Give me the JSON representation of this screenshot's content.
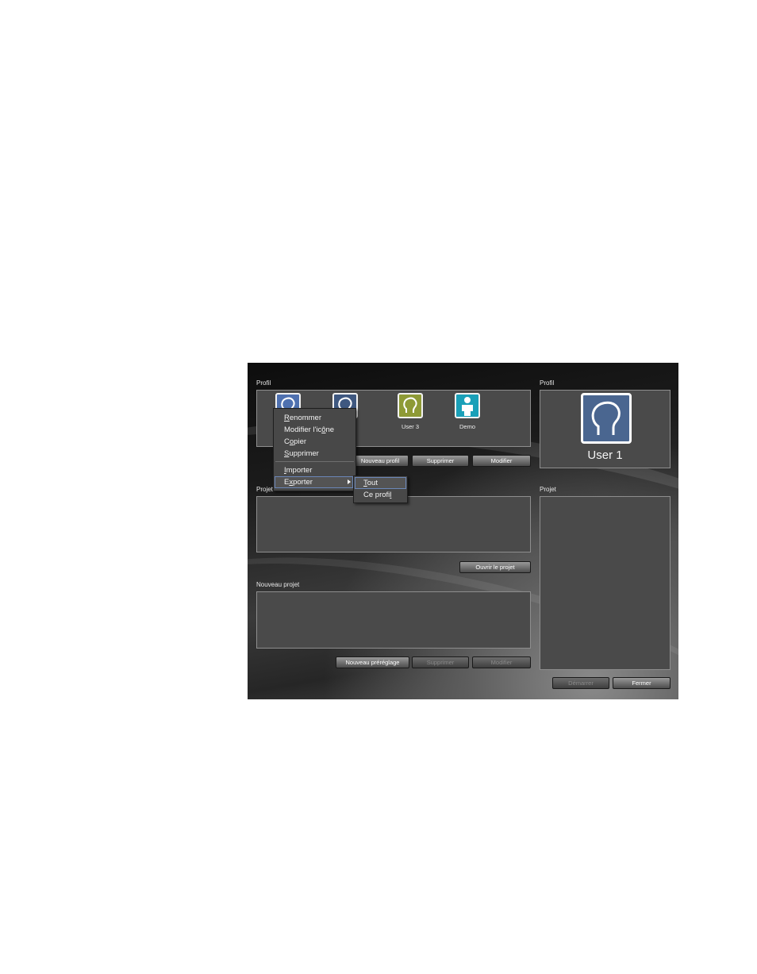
{
  "left": {
    "profile_label": "Profil",
    "profiles": [
      {
        "name": "",
        "color": "#4f71b0"
      },
      {
        "name": "",
        "color": "#3f5880"
      },
      {
        "name": "User 3",
        "color": "#8e9a36"
      },
      {
        "name": "Demo",
        "color": "#1aa0b8"
      }
    ],
    "profile_buttons": {
      "new_label": "Nouveau profil",
      "delete_label": "Supprimer",
      "edit_label": "Modifier"
    },
    "recent_label": "Projet récent",
    "open_project_label": "Ouvrir le projet",
    "new_project_label": "Nouveau projet",
    "project_buttons": {
      "new_preset_label": "Nouveau préréglage",
      "delete_label": "Supprimer",
      "edit_label": "Modifier"
    }
  },
  "right": {
    "profile_label": "Profil",
    "user_name": "User 1",
    "user_color": "#4a6690",
    "project_label": "Projet",
    "start_label": "Démarrer",
    "close_label": "Fermer"
  },
  "context_menu": {
    "items": [
      {
        "accel": "R",
        "rest": "enommer"
      },
      {
        "prefix": "Modifier l'ic",
        "accel": "ô",
        "rest": "ne"
      },
      {
        "prefix": "C",
        "accel": "o",
        "rest": "pier"
      },
      {
        "accel": "S",
        "rest": "upprimer"
      },
      {
        "accel": "I",
        "rest": "mporter"
      },
      {
        "prefix": "E",
        "accel": "x",
        "rest": "porter"
      }
    ],
    "submenu": [
      {
        "accel": "T",
        "rest": "out"
      },
      {
        "prefix": "Ce profi",
        "accel": "l",
        "rest": ""
      }
    ]
  }
}
